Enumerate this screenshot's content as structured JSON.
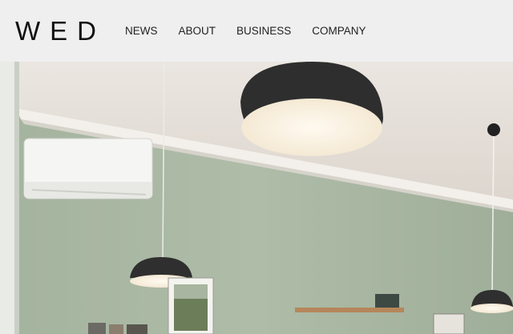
{
  "header": {
    "logo": "WED",
    "nav": [
      {
        "label": "NEWS"
      },
      {
        "label": "ABOUT"
      },
      {
        "label": "BUSINESS"
      },
      {
        "label": "COMPANY"
      }
    ]
  },
  "colors": {
    "header_bg": "#efefef",
    "wall": "#a9b8a2",
    "ceiling": "#e7e1db",
    "lamp": "#2f2f2f",
    "lamp_glow": "#fbf4e6"
  }
}
